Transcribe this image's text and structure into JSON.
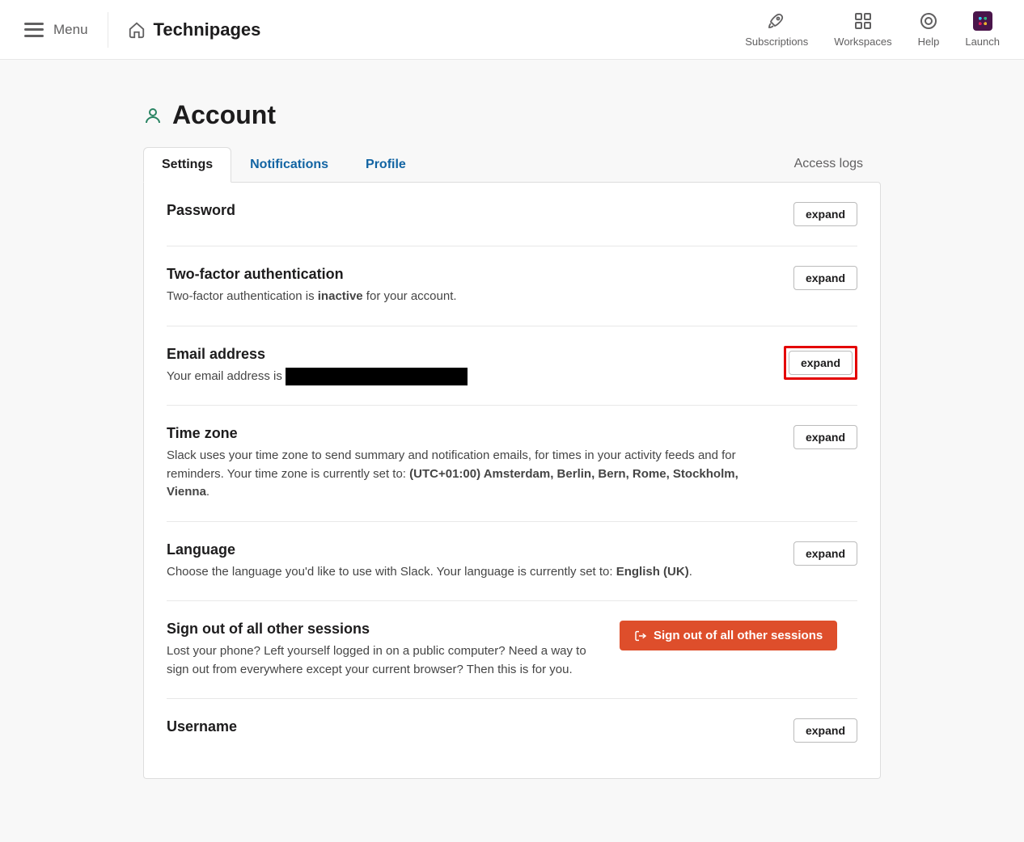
{
  "topbar": {
    "menu_label": "Menu",
    "brand": "Technipages",
    "nav": {
      "subscriptions": "Subscriptions",
      "workspaces": "Workspaces",
      "help": "Help",
      "launch": "Launch"
    }
  },
  "page": {
    "title": "Account"
  },
  "tabs": {
    "settings": "Settings",
    "notifications": "Notifications",
    "profile": "Profile",
    "access_logs": "Access logs"
  },
  "sections": {
    "password": {
      "title": "Password",
      "expand": "expand"
    },
    "twofa": {
      "title": "Two-factor authentication",
      "desc_pre": "Two-factor authentication is ",
      "desc_strong": "inactive",
      "desc_post": " for your account.",
      "expand": "expand"
    },
    "email": {
      "title": "Email address",
      "desc_pre": "Your email address is ",
      "expand": "expand"
    },
    "timezone": {
      "title": "Time zone",
      "desc_pre": "Slack uses your time zone to send summary and notification emails, for times in your activity feeds and for reminders. Your time zone is currently set to: ",
      "desc_strong": "(UTC+01:00) Amsterdam, Berlin, Bern, Rome, Stockholm, Vienna",
      "desc_post": ".",
      "expand": "expand"
    },
    "language": {
      "title": "Language",
      "desc_pre": "Choose the language you'd like to use with Slack. Your language is currently set to: ",
      "desc_strong": "English (UK)",
      "desc_post": ".",
      "expand": "expand"
    },
    "signout": {
      "title": "Sign out of all other sessions",
      "desc": "Lost your phone? Left yourself logged in on a public computer? Need a way to sign out from everywhere except your current browser? Then this is for you.",
      "button": "Sign out of all other sessions"
    },
    "username": {
      "title": "Username",
      "expand": "expand"
    }
  }
}
